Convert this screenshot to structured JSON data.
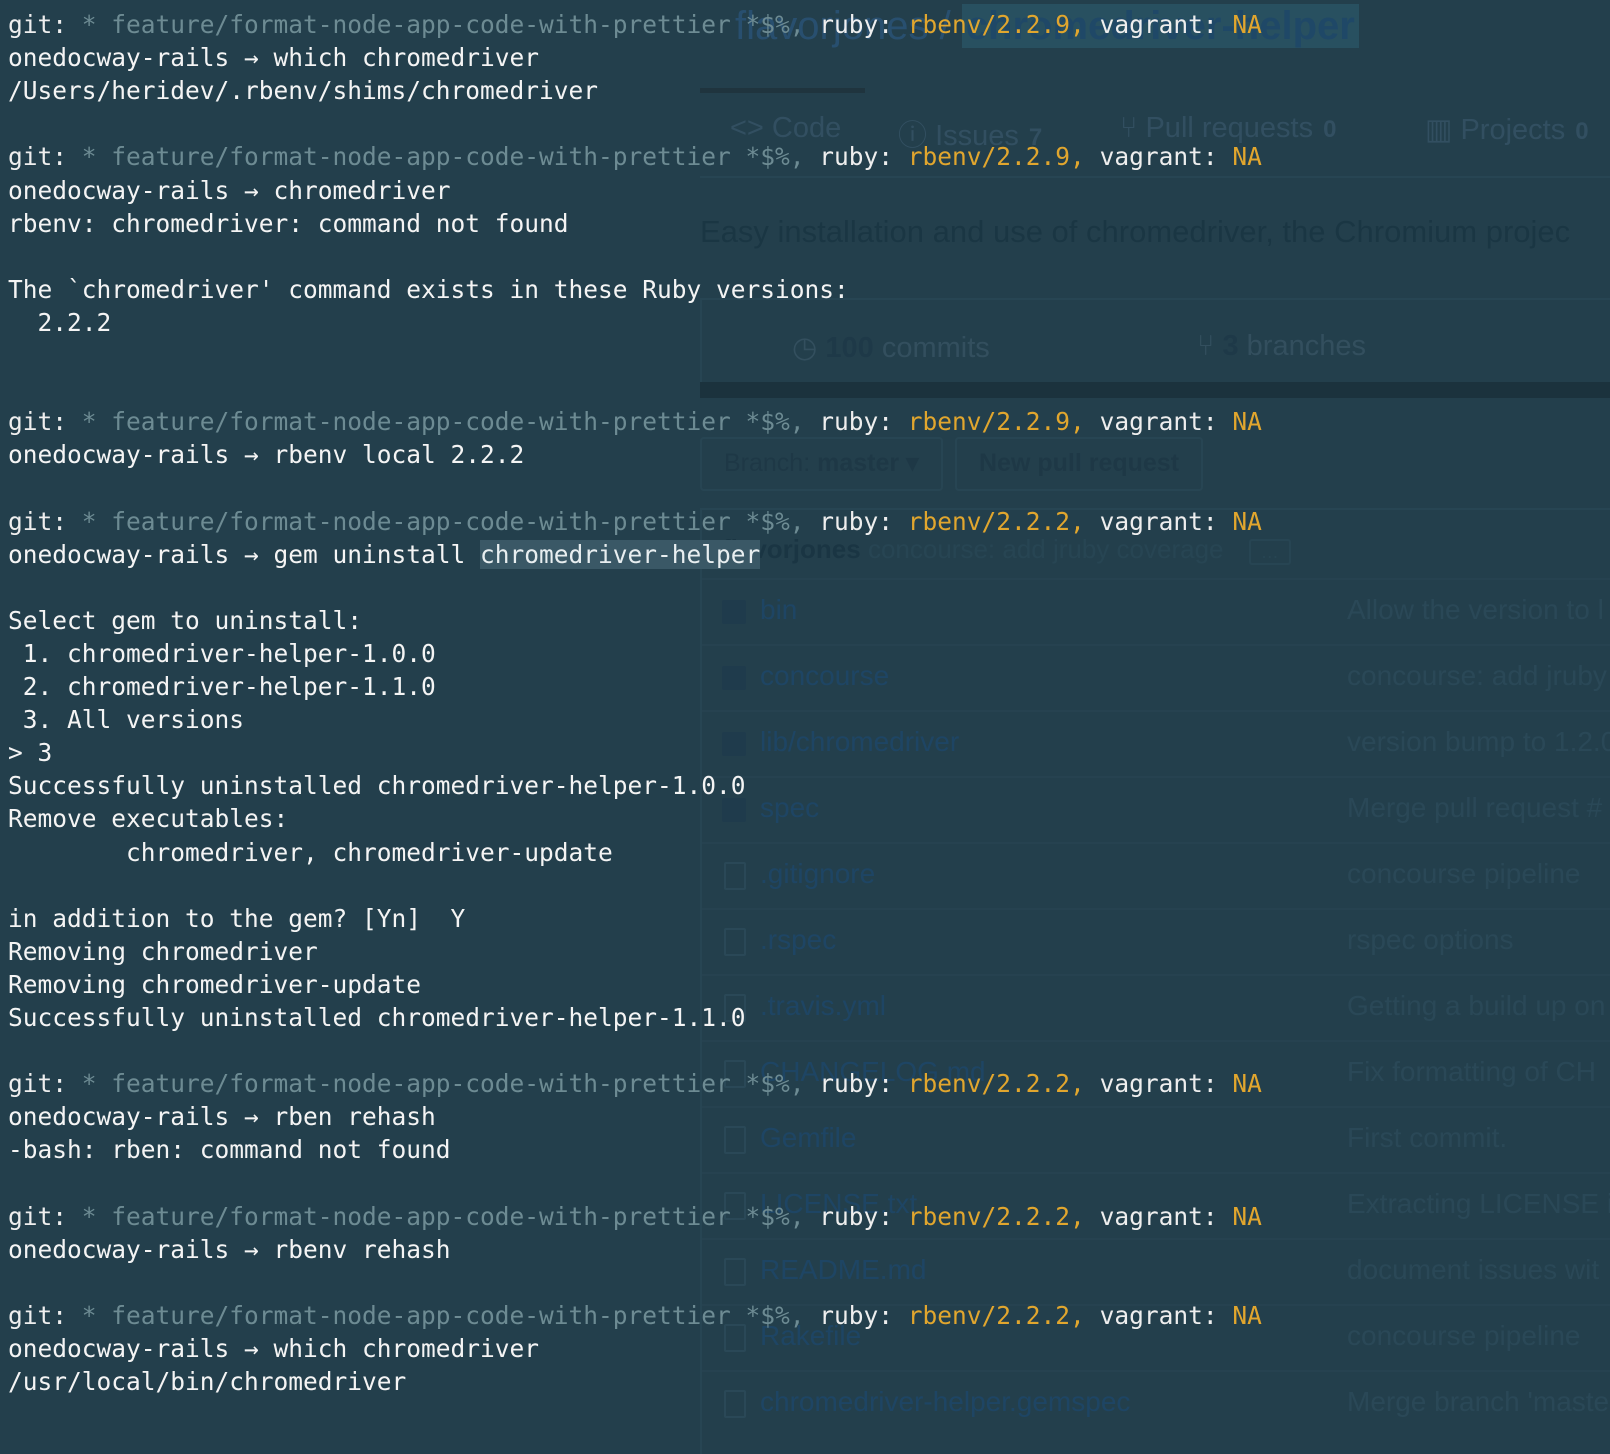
{
  "github": {
    "owner": "flavorjones",
    "separator": "/",
    "repo": "chromedriver-helper",
    "tabs": [
      {
        "label": "<> Code",
        "count": ""
      },
      {
        "label": "Issues",
        "count": "7"
      },
      {
        "label": "Pull requests",
        "count": "0"
      },
      {
        "label": "Projects",
        "count": "0"
      }
    ],
    "description": "Easy installation and use of chromedriver, the Chromium projec",
    "stats": {
      "commits_num": "100",
      "commits_label": "commits",
      "branches_num": "3",
      "branches_label": "branches"
    },
    "branch_button": {
      "prefix": "Branch:",
      "value": "master ▾"
    },
    "new_pr_button": "New pull request",
    "latest_commit": {
      "author": "flavorjones",
      "message": "concourse: add jruby coverage",
      "more": "…"
    },
    "files": [
      {
        "name": "bin",
        "type": "folder",
        "message": "Allow the version to l"
      },
      {
        "name": "concourse",
        "type": "folder",
        "message": "concourse: add jruby"
      },
      {
        "name": "lib/chromedriver",
        "type": "folder",
        "message": "version bump to 1.2.0"
      },
      {
        "name": "spec",
        "type": "folder",
        "message": "Merge pull request #"
      },
      {
        "name": ".gitignore",
        "type": "file",
        "message": "concourse pipeline"
      },
      {
        "name": ".rspec",
        "type": "file",
        "message": "rspec options"
      },
      {
        "name": ".travis.yml",
        "type": "file",
        "message": "Getting a build up on"
      },
      {
        "name": "CHANGELOG.md",
        "type": "file",
        "message": "Fix formatting of CH"
      },
      {
        "name": "Gemfile",
        "type": "file",
        "message": "First commit."
      },
      {
        "name": "LICENSE.txt",
        "type": "file",
        "message": "Extracting LICENSE i"
      },
      {
        "name": "README.md",
        "type": "file",
        "message": "document issues wit"
      },
      {
        "name": "Rakefile",
        "type": "file",
        "message": "concourse pipeline"
      },
      {
        "name": "chromedriver-helper.gemspec",
        "type": "file",
        "message": "Merge branch 'maste"
      }
    ]
  },
  "terminal": {
    "lines": [
      {
        "kind": "prompt",
        "ruby": "rbenv/2.2.9,"
      },
      {
        "kind": "cmd",
        "text": "onedocway-rails → which chromedriver"
      },
      {
        "kind": "out",
        "text": "/Users/heridev/.rbenv/shims/chromedriver"
      },
      {
        "kind": "blank"
      },
      {
        "kind": "prompt",
        "ruby": "rbenv/2.2.9,"
      },
      {
        "kind": "cmd",
        "text": "onedocway-rails → chromedriver"
      },
      {
        "kind": "out",
        "text": "rbenv: chromedriver: command not found"
      },
      {
        "kind": "blank"
      },
      {
        "kind": "out",
        "text": "The `chromedriver' command exists in these Ruby versions:"
      },
      {
        "kind": "out",
        "text": "  2.2.2"
      },
      {
        "kind": "blank"
      },
      {
        "kind": "blank"
      },
      {
        "kind": "prompt",
        "ruby": "rbenv/2.2.9,"
      },
      {
        "kind": "cmd",
        "text": "onedocway-rails → rbenv local 2.2.2"
      },
      {
        "kind": "blank"
      },
      {
        "kind": "prompt",
        "ruby": "rbenv/2.2.2,"
      },
      {
        "kind": "cmdsel",
        "text": "onedocway-rails → gem uninstall ",
        "sel": "chromedriver-helper"
      },
      {
        "kind": "blank"
      },
      {
        "kind": "out",
        "text": "Select gem to uninstall:"
      },
      {
        "kind": "out",
        "text": " 1. chromedriver-helper-1.0.0"
      },
      {
        "kind": "out",
        "text": " 2. chromedriver-helper-1.1.0"
      },
      {
        "kind": "out",
        "text": " 3. All versions"
      },
      {
        "kind": "out",
        "text": "> 3"
      },
      {
        "kind": "out",
        "text": "Successfully uninstalled chromedriver-helper-1.0.0"
      },
      {
        "kind": "out",
        "text": "Remove executables:"
      },
      {
        "kind": "out",
        "text": "        chromedriver, chromedriver-update"
      },
      {
        "kind": "blank"
      },
      {
        "kind": "out",
        "text": "in addition to the gem? [Yn]  Y"
      },
      {
        "kind": "out",
        "text": "Removing chromedriver"
      },
      {
        "kind": "out",
        "text": "Removing chromedriver-update"
      },
      {
        "kind": "out",
        "text": "Successfully uninstalled chromedriver-helper-1.1.0"
      },
      {
        "kind": "blank"
      },
      {
        "kind": "prompt",
        "ruby": "rbenv/2.2.2,"
      },
      {
        "kind": "cmd",
        "text": "onedocway-rails → rben rehash"
      },
      {
        "kind": "out",
        "text": "-bash: rben: command not found"
      },
      {
        "kind": "blank"
      },
      {
        "kind": "prompt",
        "ruby": "rbenv/2.2.2,"
      },
      {
        "kind": "cmd",
        "text": "onedocway-rails → rbenv rehash"
      },
      {
        "kind": "blank"
      },
      {
        "kind": "prompt",
        "ruby": "rbenv/2.2.2,"
      },
      {
        "kind": "cmd",
        "text": "onedocway-rails → which chromedriver"
      },
      {
        "kind": "out",
        "text": "/usr/local/bin/chromedriver"
      }
    ],
    "prompt_parts": {
      "git_label": "git:",
      "branch": " * feature/format-node-app-code-with-prettier *$%,",
      "ruby_label": " ruby: ",
      "vagrant_label": " vagrant: ",
      "vagrant_value": "NA"
    }
  }
}
